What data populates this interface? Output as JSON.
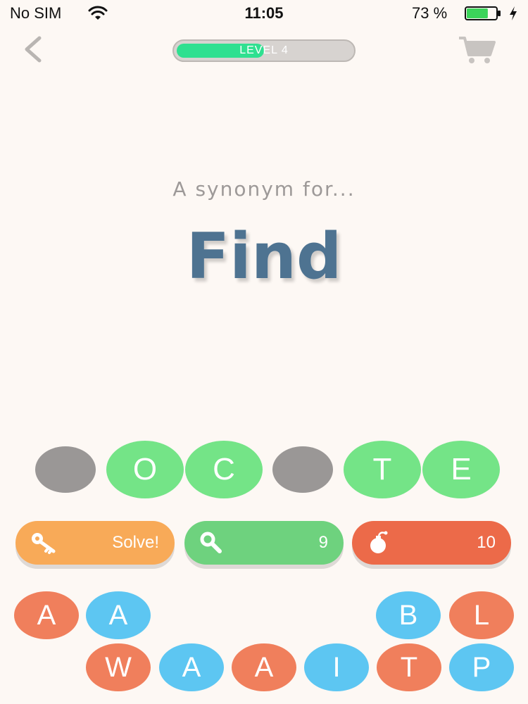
{
  "status_bar": {
    "carrier": "No SIM",
    "time": "11:05",
    "battery_percent": "73 %",
    "battery_level": 0.73,
    "battery_color": "#3bd45a"
  },
  "header": {
    "back_icon": "chevron-left-icon",
    "cart_icon": "shopping-cart-icon",
    "level_label": "LEVEL  4",
    "level_progress": 0.5,
    "progress_color": "#2fe090"
  },
  "clue": {
    "prompt": "A synonym for...",
    "word": "Find"
  },
  "answer_slots": [
    {
      "letter": "",
      "state": "empty"
    },
    {
      "letter": "O",
      "state": "filled"
    },
    {
      "letter": "C",
      "state": "filled"
    },
    {
      "letter": "",
      "state": "empty"
    },
    {
      "letter": "T",
      "state": "filled"
    },
    {
      "letter": "E",
      "state": "filled"
    }
  ],
  "powerups": {
    "solve": {
      "label": "Solve!",
      "icon": "key-icon",
      "color": "#f8aa58"
    },
    "reveal": {
      "count": "9",
      "icon": "magnifier-icon",
      "color": "#6ed27e"
    },
    "bomb": {
      "count": "10",
      "icon": "bomb-icon",
      "color": "#ec6a49"
    }
  },
  "letter_tiles": {
    "row1": [
      {
        "letter": "A",
        "color": "orange"
      },
      {
        "letter": "A",
        "color": "blue"
      },
      {
        "letter": "B",
        "color": "blue"
      },
      {
        "letter": "L",
        "color": "orange"
      }
    ],
    "row2": [
      {
        "letter": "W",
        "color": "orange"
      },
      {
        "letter": "A",
        "color": "blue"
      },
      {
        "letter": "A",
        "color": "orange"
      },
      {
        "letter": "I",
        "color": "blue"
      },
      {
        "letter": "T",
        "color": "orange"
      },
      {
        "letter": "P",
        "color": "blue"
      }
    ]
  }
}
